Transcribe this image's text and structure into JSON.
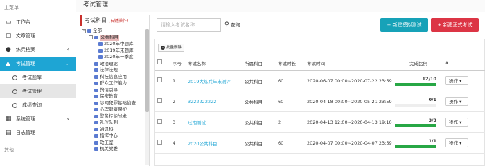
{
  "sidebar": {
    "header": "主菜单",
    "items": [
      {
        "label": "工作台"
      },
      {
        "label": "文章管理"
      },
      {
        "label": "练兵档案"
      },
      {
        "label": "考试管理"
      },
      {
        "label": "系统管理"
      },
      {
        "label": "日志管理"
      }
    ],
    "sub_items": [
      {
        "label": "考试题库"
      },
      {
        "label": "考试管理"
      },
      {
        "label": "成绩查询"
      }
    ],
    "footer": "其他"
  },
  "page": {
    "title": "考试管理"
  },
  "tree": {
    "title": "考试科目",
    "hint": "(右键操作)",
    "root": "全部",
    "selected": "公共科目",
    "children_of_selected": [
      "2020年中题库",
      "2019年末题库",
      "2020年一季度"
    ],
    "nodes": [
      "政治理论",
      "法律法规",
      "科技信息应用",
      "群众工作能力",
      "舆情引导",
      "保密教育",
      "涉网犯罪基础侦查",
      "心理健康保护",
      "警务技能战术",
      "礼仪队列",
      "通讯科",
      "指挥中心",
      "政工室",
      "机关党委"
    ]
  },
  "toolbar": {
    "search_placeholder": "请输入考试名称",
    "search_label": "查询",
    "mock_label": "+ 新建模拟测试",
    "real_label": "+ 新建正式考试",
    "bulk_delete_label": "批量删除"
  },
  "table": {
    "headers": [
      "序号",
      "考试名称",
      "所属科目",
      "考试时长",
      "考试时间",
      "完成比例",
      "#"
    ],
    "rows": [
      {
        "no": "1",
        "name": "2019大练兵年末测评",
        "subject": "公共科目",
        "duration": "60",
        "time": "2020-06-07 00:00~2020-07-22 23:59",
        "progress": "12/10",
        "ratio": 1.0,
        "op": "操作"
      },
      {
        "no": "2",
        "name": "3222222222",
        "subject": "公共科目",
        "duration": "60",
        "time": "2020-04-18 00:00~2020-05-21 23:59",
        "progress": "0/1",
        "ratio": 0.0,
        "op": "操作"
      },
      {
        "no": "3",
        "name": "过期测试",
        "subject": "公共科目",
        "duration": "2",
        "time": "2020-04-13 12:00~2020-04-13 19:10",
        "progress": "3/3",
        "ratio": 1.0,
        "op": "操作"
      },
      {
        "no": "4",
        "name": "2020公共科目",
        "subject": "公共科目",
        "duration": "60",
        "time": "2020-04-07 00:00~2020-04-07 23:59",
        "progress": "1/1",
        "ratio": 1.0,
        "op": "操作"
      }
    ]
  },
  "colors": {
    "accent": "#1ea5d4",
    "danger": "#dc3545",
    "info": "#17a2b8",
    "progress": "#28a745"
  }
}
